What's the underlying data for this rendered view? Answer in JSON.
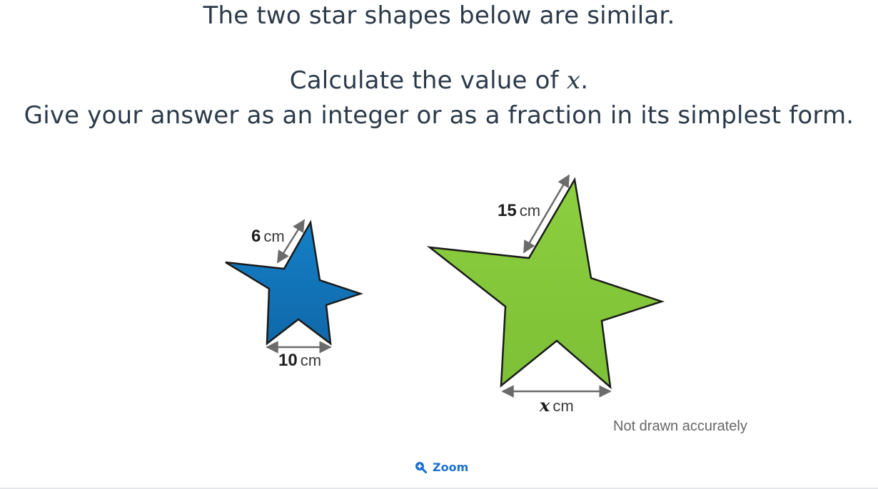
{
  "question": {
    "line1": "The two star shapes below are similar.",
    "line2_pre": "Calculate the value of ",
    "line2_var": "x",
    "line2_post": ".",
    "line3": "Give your answer as an integer or as a fraction in its simplest form."
  },
  "diagram": {
    "small_star": {
      "color": "#1474b8",
      "arm_label": {
        "value": "6",
        "unit": "cm"
      },
      "base_label": {
        "value": "10",
        "unit": "cm"
      }
    },
    "large_star": {
      "color": "#86c83c",
      "arm_label": {
        "value": "15",
        "unit": "cm"
      },
      "base_label": {
        "value": "x",
        "unit": "cm"
      }
    },
    "note": "Not drawn accurately"
  },
  "controls": {
    "zoom_label": "Zoom",
    "zoom_icon": "zoom-in-icon"
  }
}
